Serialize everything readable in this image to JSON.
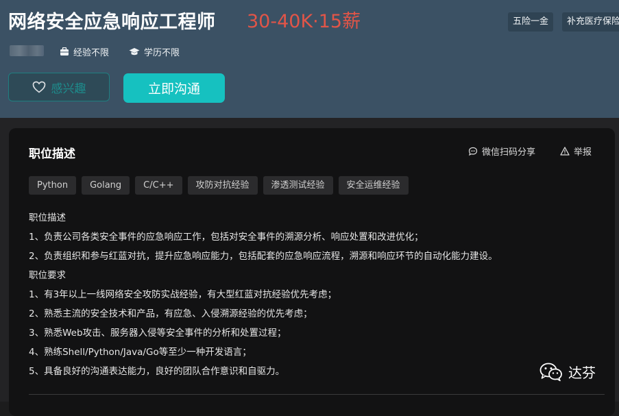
{
  "job": {
    "title": "网络安全应急响应工程师",
    "salary": "30-40K·15薪",
    "welfare": [
      "五险一金",
      "补充医疗保险"
    ],
    "experience": "经验不限",
    "education": "学历不限"
  },
  "actions": {
    "interest_label": "感兴趣",
    "chat_label": "立即沟通"
  },
  "detail": {
    "section_title": "职位描述",
    "share_label": "微信扫码分享",
    "report_label": "举报",
    "tags": [
      "Python",
      "Golang",
      "C/C++",
      "攻防对抗经验",
      "渗透测试经验",
      "安全运维经验"
    ],
    "lines": [
      "职位描述",
      "1、负责公司各类安全事件的应急响应工作，包括对安全事件的溯源分析、响应处置和改进优化；",
      "2、负责组织和参与红蓝对抗，提升应急响应能力，包括配套的应急响应流程，溯源和响应环节的自动化能力建设。",
      "职位要求",
      "1、有3年以上一线网络安全攻防实战经验，有大型红蓝对抗经验优先考虑；",
      "2、熟悉主流的安全技术和产品，有应急、入侵溯源经验的优先考虑；",
      "3、熟悉Web攻击、服务器入侵等安全事件的分析和处置过程；",
      "4、熟练Shell/Python/Java/Go等至少一种开发语言；",
      "5、具备良好的沟通表达能力，良好的团队合作意识和自驱力。"
    ]
  },
  "watermark": {
    "text": "达芬",
    "icon": "wechat-icon"
  },
  "icons": {
    "experience": "briefcase-icon",
    "education": "graduation-cap-icon",
    "interest": "heart-icon",
    "share": "chat-bubble-icon",
    "report": "warning-icon"
  },
  "colors": {
    "header_bg": "#3b5164",
    "salary": "#e15548",
    "accent": "#16c1c0",
    "card_bg": "#121213"
  }
}
